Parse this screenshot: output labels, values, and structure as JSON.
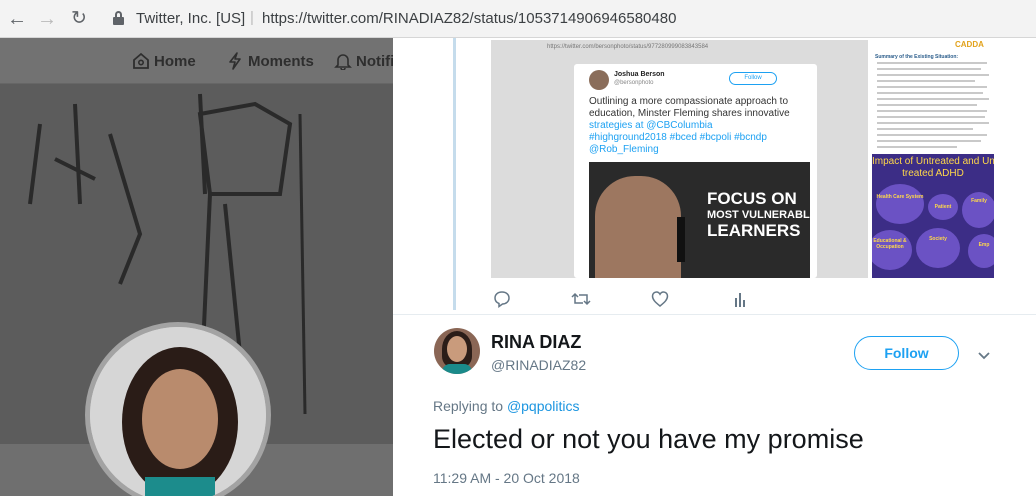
{
  "browser": {
    "site_identity": "Twitter, Inc. [US]",
    "url": "https://twitter.com/RINADIAZ82/status/1053714906946580480",
    "separator": "|"
  },
  "twitter_nav": {
    "items": [
      {
        "label": "Home",
        "icon": "home-icon"
      },
      {
        "label": "Moments",
        "icon": "lightning-icon"
      },
      {
        "label": "Notifi",
        "icon": "bell-icon"
      }
    ]
  },
  "embedded_screenshot": {
    "url": "https://twitter.com/bersonphoto/status/977280999083843584",
    "author_name": "Joshua Berson",
    "author_handle": "@bersonphoto",
    "follow_label": "Follow",
    "text_lines": [
      "Outlining a more compassionate approach to",
      "education, Minster Fleming shares innovative",
      "strategies at @CBColumbia",
      "#highground2018 #bced #bcpoli #bcndp",
      "@Rob_Fleming"
    ],
    "photo_headline": [
      "FOCUS ON",
      "MOST VULNERABLE",
      "LEARNERS"
    ]
  },
  "embedded_document": {
    "logo": "CADDA",
    "heading": "Summary of the Existing Situation:",
    "infographic_title_1": "Impact of Untreated and Und",
    "infographic_title_2": "treated ADHD",
    "bubbles": [
      "Health Care System",
      "Patient",
      "Family",
      "Society",
      "Educational & Occupation",
      "Emp"
    ]
  },
  "actions": {
    "reply": "reply-icon",
    "retweet": "retweet-icon",
    "like": "heart-icon",
    "analytics": "analytics-icon"
  },
  "tweet": {
    "author_name": "RINA DIAZ",
    "author_handle": "@RINADIAZ82",
    "follow_label": "Follow",
    "replying_prefix": "Replying to",
    "replying_mention": "@pqpolitics",
    "text": "Elected or not you have my promise",
    "timestamp": "11:29 AM - 20 Oct 2018"
  },
  "colors": {
    "twitter_blue": "#1da1f2",
    "link_blue": "#1b95e0",
    "text_dark": "#14171a",
    "text_gray": "#657786",
    "overlay_gray": "#6f6f6f"
  }
}
